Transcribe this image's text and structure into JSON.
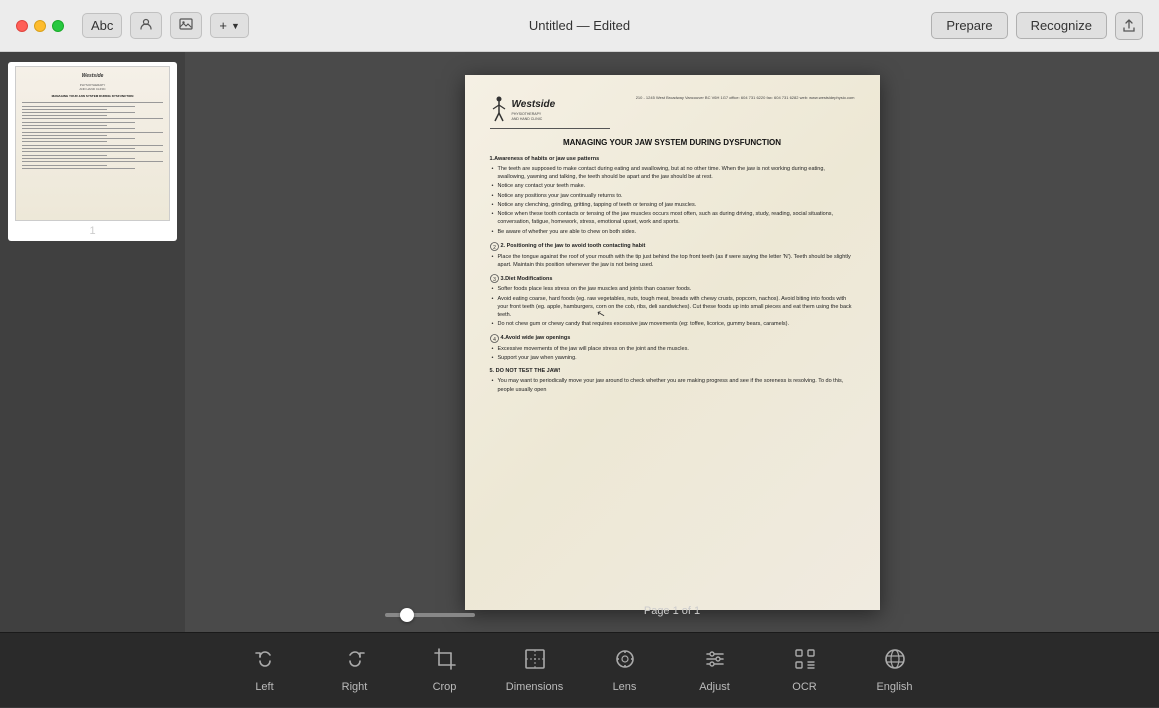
{
  "titlebar": {
    "title": "Untitled — Edited",
    "prepare_btn": "Prepare",
    "recognize_btn": "Recognize"
  },
  "toolbar": {
    "text_btn": "Abc",
    "contact_btn": "👤",
    "image_btn": "🖼",
    "add_btn": "+"
  },
  "sidebar": {
    "page_number": "1"
  },
  "document": {
    "logo": "Westside",
    "logo_sub": "PHYSIOTHERAPY\nAND HAND CLINIC",
    "address": "210 - 1245 West Broadway\nVancouver BC V6H 1G7\noffice: 604 731 6220\nfax: 604 731 6282\nweb: www.westsidephysio.com",
    "title": "MANAGING YOUR JAW SYSTEM DURING DYSFUNCTION",
    "section1_title": "1.Awareness of habits or jaw use patterns",
    "section1_bullets": [
      "The teeth are supposed to make contact during eating and swallowing, but at no other time. When the jaw is not working during eating, swallowing, yawning and talking, the teeth should be apart and the jaw should be at rest.",
      "Notice any contact your teeth make.",
      "Notice any positions your jaw continually returns to.",
      "Notice any clenching, grinding, gritting, tapping of teeth or tensing of jaw muscles.",
      "Notice when these tooth contacts or tensing of the jaw muscles occurs most often, such as during driving, study, reading, social situations, conversation, fatigue, homework, stress, emotional upset, work and sports.",
      "Be aware of whether you are able to chew on both sides."
    ],
    "section2_title": "2. Positioning of the jaw to avoid tooth contacting habit",
    "section2_bullets": [
      "Place the tongue against the roof of your mouth with the tip just behind the top front teeth (as if were saying the letter 'N'). Teeth should be slightly apart. Maintain this position whenever the jaw is not being used."
    ],
    "section3_title": "3.Diet Modifications",
    "section3_bullets": [
      "Softer foods place less stress on the jaw muscles and joints than coarser foods.",
      "Avoid eating coarse, hard foods (eg. raw vegetables, nuts, tough meat, breads with chewy crusts, popcorn, nachos). Avoid biting into foods with your front teeth (eg. apple, hamburgers, corn on the cob, ribs, deli sandwiches). Cut these foods up into small pieces and eat them using the back teeth.",
      "Do not chew gum or chewy candy that requires excessive jaw movements (eg: toffee, licorice, gummy bears, caramels)."
    ],
    "section4_title": "4.Avoid wide jaw openings",
    "section4_bullets": [
      "Excessive movements of the jaw will place stress on the joint and the muscles.",
      "Support your jaw when yawning."
    ],
    "section5_title": "5. DO NOT TEST THE JAW!",
    "section5_bullets": [
      "You may want to periodically move your jaw around to check whether you are making progress and see if the soreness is resolving. To do this, people usually open"
    ]
  },
  "bottom_tools": [
    {
      "id": "rotate-left",
      "label": "Left",
      "icon": "↺"
    },
    {
      "id": "rotate-right",
      "label": "Right",
      "icon": "↻"
    },
    {
      "id": "crop",
      "label": "Crop",
      "icon": "⊡"
    },
    {
      "id": "dimensions",
      "label": "Dimensions",
      "icon": "⊞"
    },
    {
      "id": "lens",
      "label": "Lens",
      "icon": "⊙"
    },
    {
      "id": "adjust",
      "label": "Adjust",
      "icon": "⊕"
    },
    {
      "id": "ocr",
      "label": "OCR",
      "icon": "T"
    },
    {
      "id": "english",
      "label": "English",
      "icon": "🌐"
    }
  ],
  "footer": {
    "page_indicator": "Page 1 of 1"
  }
}
